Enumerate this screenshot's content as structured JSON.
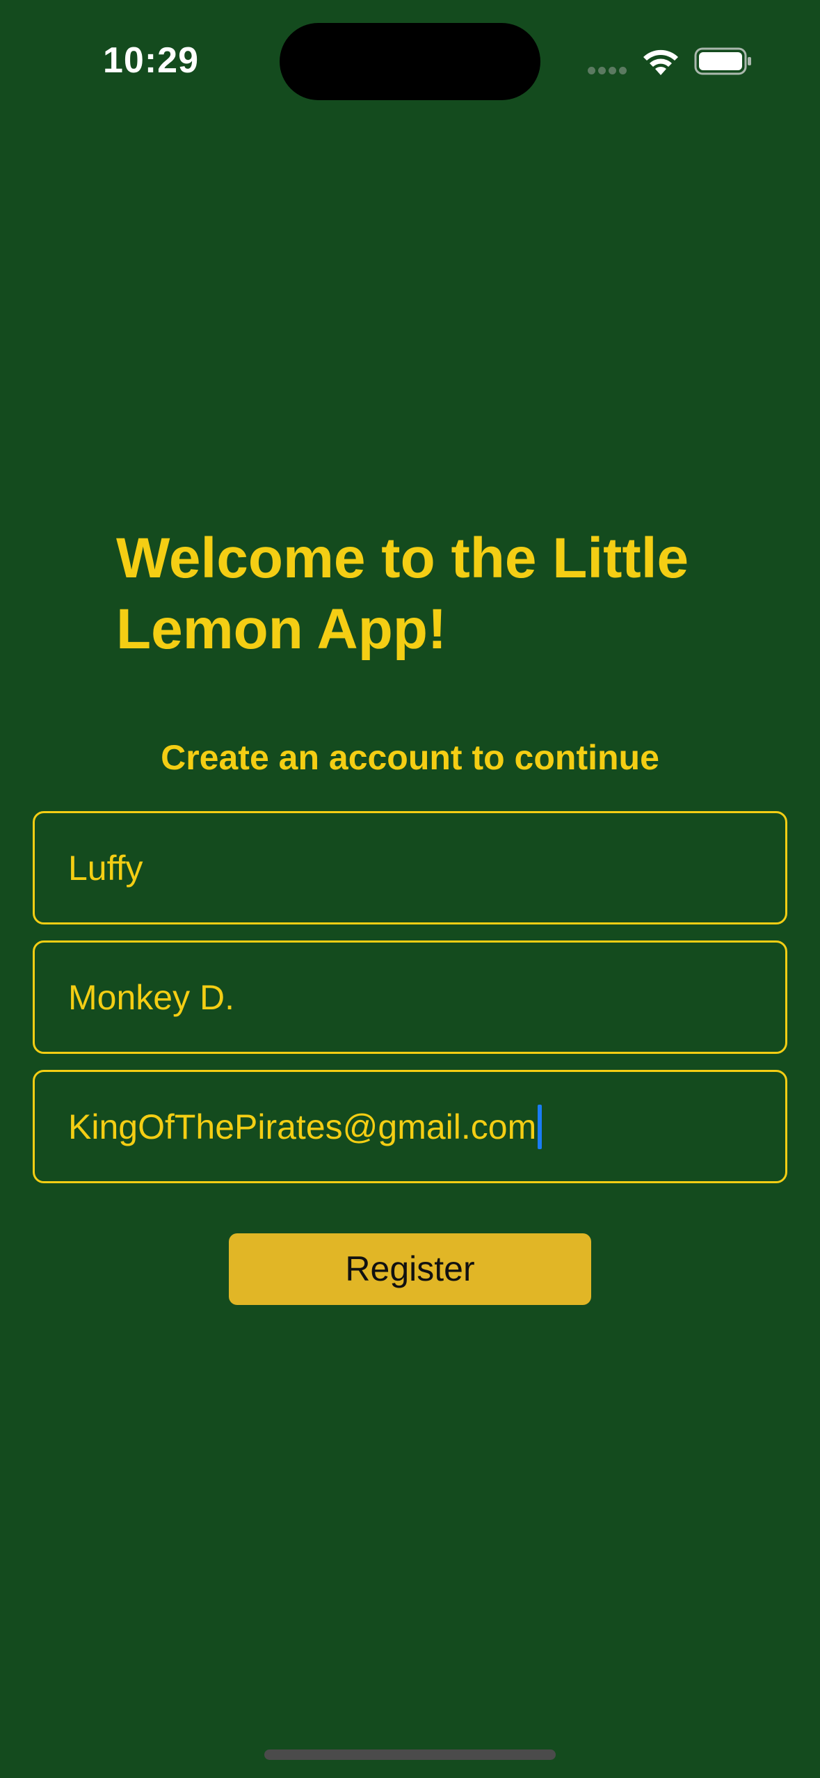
{
  "status_bar": {
    "time": "10:29",
    "icons": [
      "signal-dots-icon",
      "wifi-icon",
      "battery-icon"
    ]
  },
  "onboarding": {
    "title": "Welcome to the Little Lemon App!",
    "subtitle": "Create an account to continue",
    "fields": {
      "first_name": "Luffy",
      "last_name": "Monkey D.",
      "email": "KingOfThePirates@gmail.com"
    },
    "register_label": "Register"
  },
  "colors": {
    "background": "#144b1e",
    "accent": "#f4ce14",
    "button": "#e1b626",
    "cursor": "#1a7cf5"
  }
}
